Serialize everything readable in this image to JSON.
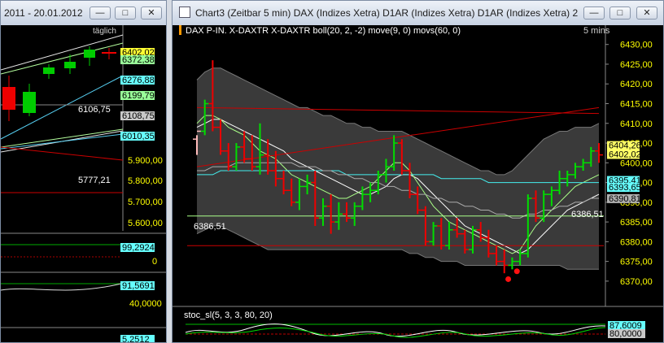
{
  "left_window": {
    "title": "2011 - 20.01.2012",
    "period_label": "täglich",
    "axis_ticks": [
      "5.900,00",
      "5.800,00",
      "5.700,00",
      "5.600,00"
    ],
    "price_tags": [
      "6402,02",
      "6372,38",
      "6276,88",
      "6199,79",
      "6108,75",
      "6010,35"
    ],
    "line_labels": [
      "6106,75",
      "5777,21"
    ],
    "panel_tags": [
      "99,2924",
      "0",
      "91,5691",
      "40,0000",
      "5,2512"
    ],
    "colors": {
      "up": "#00cc00",
      "down": "#ee0000",
      "axis": "#ffff00"
    }
  },
  "right_window": {
    "title": "Chart3 (Zeitbar 5 min)   DAX (Indizes Xetra) D1AR (Indizes Xetra) D1AR (Indizes Xetra) 20...",
    "chart_header": "DAX P-IN. X-DAXTR X-DAXTR boll(20, 2, -2) move(9, 0) movs(60, 0)",
    "timeframe": "5 mins",
    "line_label": "6386,51",
    "stoch_label": "stoc_sl(5, 3, 3, 80, 20)",
    "price_tags": [
      {
        "text": "6404,26",
        "color": "#ffff66"
      },
      {
        "text": "6402,02",
        "color": "#ffff66"
      },
      {
        "text": "6395,41",
        "color": "#66ffff"
      },
      {
        "text": "6393,65",
        "color": "#66ffff"
      },
      {
        "text": "6390,81",
        "color": "#b0b0b0"
      }
    ],
    "stoch_tags": [
      "87,6009",
      "80,0000"
    ]
  },
  "chart_data": [
    {
      "type": "candlestick",
      "title": "DAX P-IN. X-DAXTR X-DAXTR boll(20, 2, -2) move(9, 0) movs(60, 0)",
      "timeframe": "5 mins",
      "y_ticks": [
        6430,
        6425,
        6420,
        6415,
        6410,
        6405,
        6400,
        6395,
        6390,
        6385,
        6380,
        6375,
        6370
      ],
      "y_tick_labels": [
        "6430,00",
        "6425,00",
        "6420,00",
        "6415,00",
        "6410,00",
        "6405,00",
        "6400,00",
        "6395,00",
        "6390,00",
        "6385,00",
        "6380,00",
        "6375,00",
        "6370,00"
      ],
      "ylim": [
        6364,
        6432
      ],
      "bars": [
        {
          "o": 6406,
          "h": 6407,
          "l": 6402,
          "c": 6408
        },
        {
          "o": 6408,
          "h": 6416,
          "l": 6407,
          "c": 6415
        },
        {
          "o": 6415,
          "h": 6426,
          "l": 6408,
          "c": 6409
        },
        {
          "o": 6409,
          "h": 6411,
          "l": 6402,
          "c": 6403
        },
        {
          "o": 6403,
          "h": 6405,
          "l": 6398,
          "c": 6399
        },
        {
          "o": 6399,
          "h": 6405,
          "l": 6398,
          "c": 6404
        },
        {
          "o": 6404,
          "h": 6408,
          "l": 6400,
          "c": 6401
        },
        {
          "o": 6401,
          "h": 6407,
          "l": 6398,
          "c": 6399
        },
        {
          "o": 6399,
          "h": 6410,
          "l": 6397,
          "c": 6402
        },
        {
          "o": 6402,
          "h": 6406,
          "l": 6397,
          "c": 6398
        },
        {
          "o": 6398,
          "h": 6403,
          "l": 6394,
          "c": 6396
        },
        {
          "o": 6396,
          "h": 6398,
          "l": 6392,
          "c": 6393
        },
        {
          "o": 6393,
          "h": 6396,
          "l": 6389,
          "c": 6390
        },
        {
          "o": 6390,
          "h": 6396,
          "l": 6388,
          "c": 6394
        },
        {
          "o": 6394,
          "h": 6397,
          "l": 6392,
          "c": 6395
        },
        {
          "o": 6395,
          "h": 6398,
          "l": 6384,
          "c": 6386
        },
        {
          "o": 6386,
          "h": 6391,
          "l": 6384,
          "c": 6389
        },
        {
          "o": 6389,
          "h": 6392,
          "l": 6382,
          "c": 6385
        },
        {
          "o": 6385,
          "h": 6390,
          "l": 6383,
          "c": 6387
        },
        {
          "o": 6387,
          "h": 6390,
          "l": 6385,
          "c": 6386
        },
        {
          "o": 6386,
          "h": 6390,
          "l": 6384,
          "c": 6389
        },
        {
          "o": 6389,
          "h": 6394,
          "l": 6388,
          "c": 6392
        },
        {
          "o": 6392,
          "h": 6395,
          "l": 6390,
          "c": 6393
        },
        {
          "o": 6393,
          "h": 6398,
          "l": 6392,
          "c": 6397
        },
        {
          "o": 6397,
          "h": 6401,
          "l": 6395,
          "c": 6399
        },
        {
          "o": 6399,
          "h": 6407,
          "l": 6398,
          "c": 6405
        },
        {
          "o": 6405,
          "h": 6406,
          "l": 6397,
          "c": 6398
        },
        {
          "o": 6398,
          "h": 6400,
          "l": 6391,
          "c": 6392
        },
        {
          "o": 6392,
          "h": 6394,
          "l": 6387,
          "c": 6388
        },
        {
          "o": 6388,
          "h": 6389,
          "l": 6379,
          "c": 6380
        },
        {
          "o": 6380,
          "h": 6385,
          "l": 6379,
          "c": 6384
        },
        {
          "o": 6384,
          "h": 6386,
          "l": 6378,
          "c": 6379
        },
        {
          "o": 6379,
          "h": 6385,
          "l": 6378,
          "c": 6383
        },
        {
          "o": 6383,
          "h": 6386,
          "l": 6381,
          "c": 6382
        },
        {
          "o": 6382,
          "h": 6383,
          "l": 6377,
          "c": 6378
        },
        {
          "o": 6378,
          "h": 6384,
          "l": 6377,
          "c": 6383
        },
        {
          "o": 6383,
          "h": 6385,
          "l": 6380,
          "c": 6381
        },
        {
          "o": 6381,
          "h": 6383,
          "l": 6376,
          "c": 6377
        },
        {
          "o": 6377,
          "h": 6379,
          "l": 6374,
          "c": 6375
        },
        {
          "o": 6375,
          "h": 6378,
          "l": 6372,
          "c": 6374
        },
        {
          "o": 6374,
          "h": 6376,
          "l": 6373,
          "c": 6375
        },
        {
          "o": 6375,
          "h": 6378,
          "l": 6374,
          "c": 6377
        },
        {
          "o": 6377,
          "h": 6392,
          "l": 6376,
          "c": 6391
        },
        {
          "o": 6391,
          "h": 6393,
          "l": 6385,
          "c": 6386
        },
        {
          "o": 6386,
          "h": 6393,
          "l": 6385,
          "c": 6392
        },
        {
          "o": 6392,
          "h": 6394,
          "l": 6389,
          "c": 6393
        },
        {
          "o": 6393,
          "h": 6398,
          "l": 6392,
          "c": 6396
        },
        {
          "o": 6396,
          "h": 6398,
          "l": 6394,
          "c": 6397
        },
        {
          "o": 6397,
          "h": 6400,
          "l": 6396,
          "c": 6399
        },
        {
          "o": 6399,
          "h": 6401,
          "l": 6398,
          "c": 6400
        },
        {
          "o": 6400,
          "h": 6404,
          "l": 6399,
          "c": 6403
        },
        {
          "o": 6403,
          "h": 6405,
          "l": 6400,
          "c": 6402
        }
      ],
      "series": [
        {
          "values": [
            6409,
            6410,
            6411,
            6411,
            6410,
            6409,
            6408,
            6407,
            6406,
            6405,
            6404,
            6403,
            6401,
            6400,
            6399,
            6398,
            6397,
            6396,
            6395,
            6394,
            6393,
            6392,
            6392,
            6393,
            6394,
            6396,
            6397,
            6397,
            6396,
            6394,
            6392,
            6390,
            6388,
            6386,
            6384,
            6383,
            6382,
            6381,
            6380,
            6379,
            6378,
            6377,
            6378,
            6380,
            6382,
            6384,
            6386,
            6388,
            6389,
            6390,
            6391,
            6392
          ]
        },
        {
          "values": [
            6410,
            6412,
            6412,
            6411,
            6409,
            6408,
            6407,
            6405,
            6403,
            6402,
            6401,
            6399,
            6397,
            6396,
            6395,
            6394,
            6393,
            6392,
            6391,
            6391,
            6392,
            6393,
            6394,
            6396,
            6398,
            6400,
            6400,
            6398,
            6395,
            6392,
            6389,
            6387,
            6385,
            6384,
            6383,
            6382,
            6381,
            6380,
            6379,
            6378,
            6377,
            6378,
            6381,
            6384,
            6386,
            6388,
            6390,
            6392,
            6394,
            6395,
            6396,
            6397
          ]
        },
        {
          "values": [
            6397,
            6397,
            6397,
            6398,
            6398,
            6398,
            6398,
            6398,
            6398,
            6398,
            6398,
            6398,
            6398,
            6398,
            6398,
            6398,
            6398,
            6398,
            6398,
            6397,
            6397,
            6397,
            6397,
            6397,
            6397,
            6397,
            6397,
            6397,
            6397,
            6397,
            6397,
            6396,
            6396,
            6396,
            6396,
            6396,
            6396,
            6395,
            6395,
            6395,
            6395,
            6395,
            6395,
            6395,
            6395,
            6395,
            6395,
            6395,
            6395,
            6395,
            6395,
            6395
          ]
        },
        {
          "values": [
            6398,
            6398,
            6399,
            6399,
            6399,
            6400,
            6400,
            6400,
            6400,
            6400,
            6400,
            6400,
            6400,
            6399,
            6399,
            6399,
            6398,
            6398,
            6397,
            6397,
            6396,
            6396,
            6395,
            6395,
            6394,
            6394,
            6393,
            6393,
            6392,
            6392,
            6391,
            6391,
            6390,
            6390,
            6389,
            6389,
            6388,
            6388,
            6387,
            6387,
            6386,
            6386,
            6387,
            6387,
            6388,
            6388,
            6389,
            6389,
            6390,
            6390,
            6391,
            6391
          ]
        },
        {
          "values": [
            6421,
            6423,
            6424,
            6424,
            6423,
            6422,
            6421,
            6420,
            6419,
            6418,
            6417,
            6416,
            6415,
            6414,
            6414,
            6413,
            6412,
            6412,
            6411,
            6410,
            6410,
            6409,
            6409,
            6408,
            6408,
            6408,
            6408,
            6407,
            6406,
            6405,
            6404,
            6403,
            6402,
            6401,
            6400,
            6399,
            6398,
            6398,
            6397,
            6397,
            6398,
            6400,
            6402,
            6404,
            6406,
            6407,
            6408,
            6408,
            6409,
            6409,
            6409,
            6410
          ]
        },
        {
          "values": [
            6382,
            6383,
            6384,
            6384,
            6383,
            6382,
            6381,
            6380,
            6379,
            6378,
            6378,
            6378,
            6378,
            6378,
            6378,
            6378,
            6378,
            6378,
            6378,
            6378,
            6378,
            6378,
            6378,
            6378,
            6378,
            6378,
            6378,
            6377,
            6377,
            6376,
            6376,
            6375,
            6375,
            6375,
            6374,
            6374,
            6374,
            6374,
            6374,
            6374,
            6374,
            6374,
            6374,
            6374,
            6374,
            6374,
            6374,
            6373,
            6373,
            6373,
            6373,
            6373
          ]
        }
      ],
      "horizontal_lines": [
        6386.51,
        6379
      ],
      "trend_line": {
        "from": [
          0,
          6399
        ],
        "to": [
          51,
          6414
        ]
      },
      "trend_line_2": {
        "from": [
          0,
          6414
        ],
        "to": [
          51,
          6412.5
        ]
      },
      "marker_points": [
        {
          "x": 39.5,
          "y": 6370.5
        },
        {
          "x": 40.6,
          "y": 6372.5
        }
      ]
    }
  ]
}
